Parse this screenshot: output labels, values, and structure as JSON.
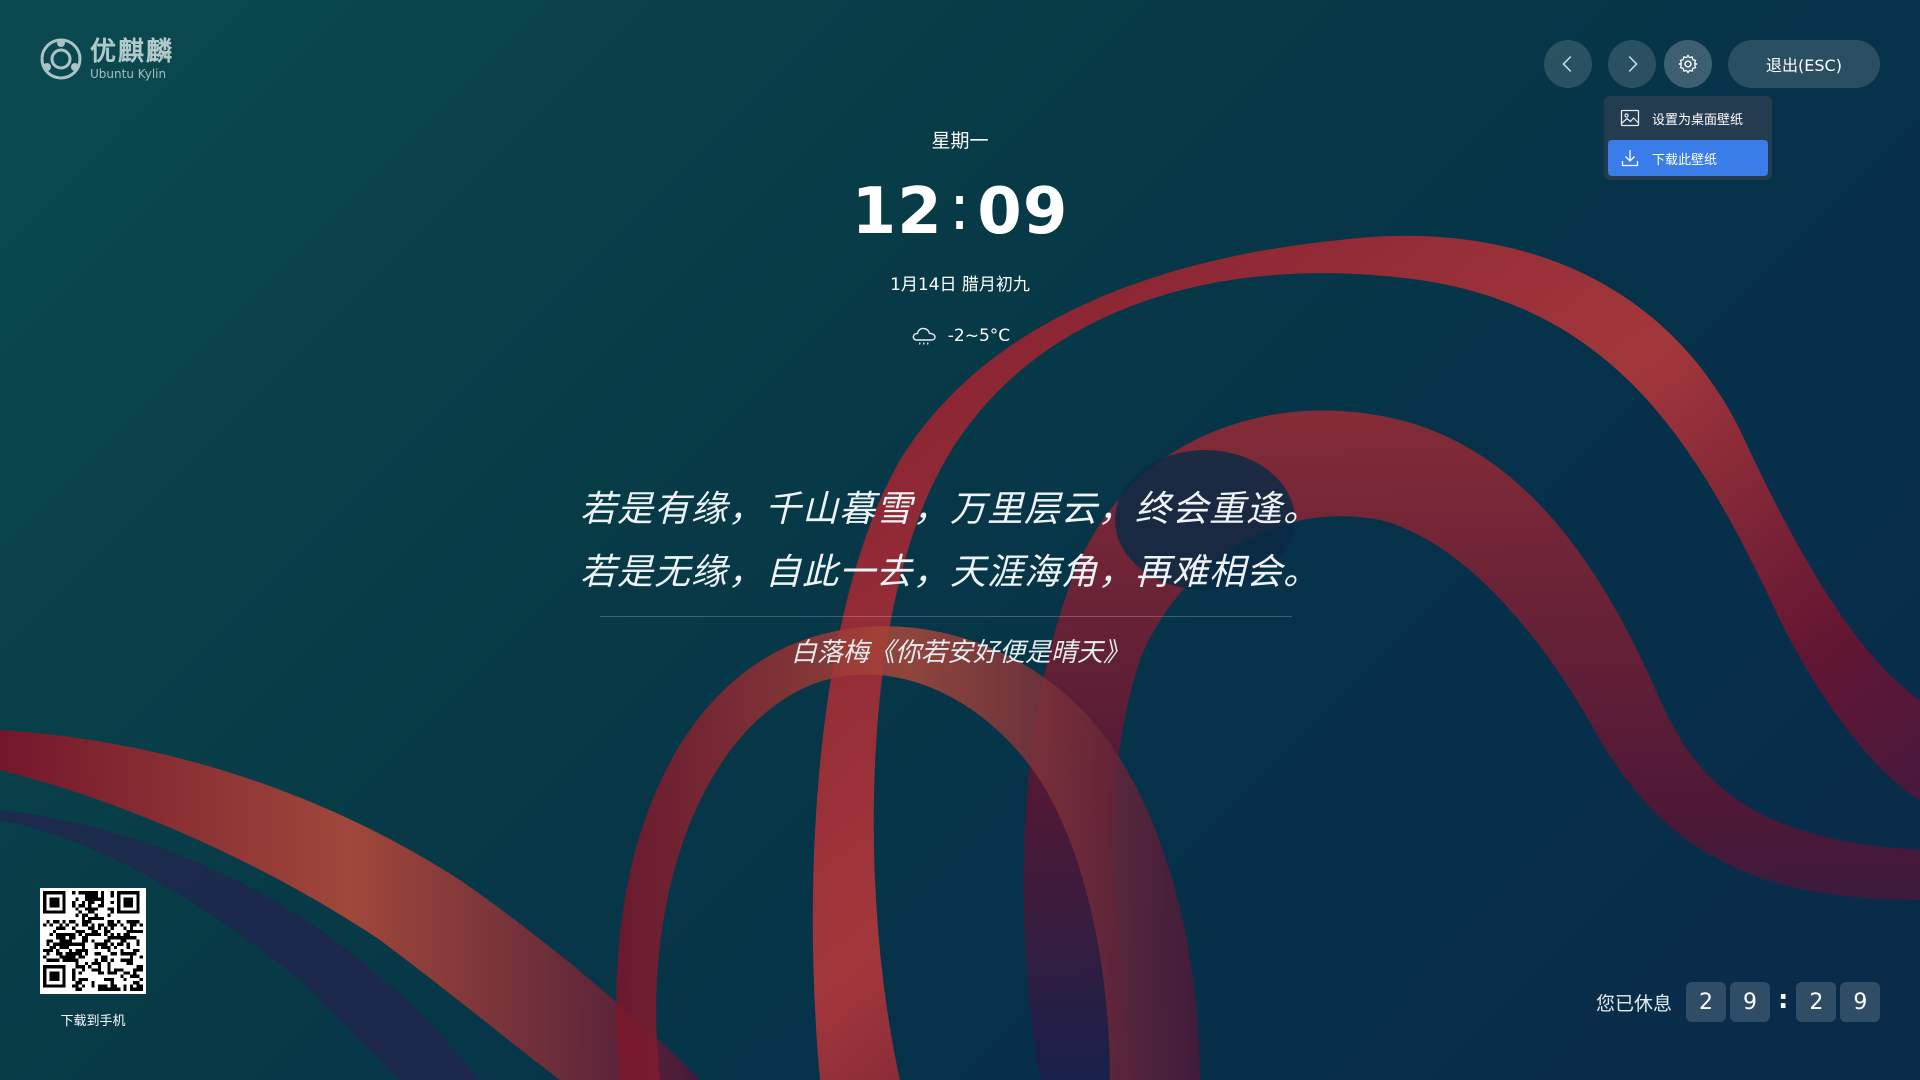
{
  "logo": {
    "name_cn": "优麒麟",
    "name_en": "Ubuntu Kylin"
  },
  "toolbar": {
    "prev_icon": "chevron-left-icon",
    "next_icon": "chevron-right-icon",
    "settings_icon": "gear-icon",
    "exit_label": "退出(ESC)"
  },
  "menu": {
    "items": [
      {
        "label": "设置为桌面壁纸",
        "icon": "image-icon",
        "active": false
      },
      {
        "label": "下载此壁纸",
        "icon": "download-icon",
        "active": true
      }
    ],
    "active_color": "#3b7de8"
  },
  "clock": {
    "weekday": "星期一",
    "hours": "12",
    "separator": ":",
    "minutes": "09",
    "date": "1月14日 腊月初九",
    "weather_icon": "cloud-icon",
    "temperature": "-2~5°C"
  },
  "quote": {
    "line1": "若是有缘，千山暮雪，万里层云，终会重逢。",
    "line2": "若是无缘，自此一去，天涯海角，再难相会。",
    "source": "白落梅《你若安好便是晴天》"
  },
  "qr": {
    "label": "下载到手机"
  },
  "rest_timer": {
    "label": "您已休息",
    "digits": [
      "2",
      "9",
      "2",
      "9"
    ],
    "separator": ":"
  }
}
